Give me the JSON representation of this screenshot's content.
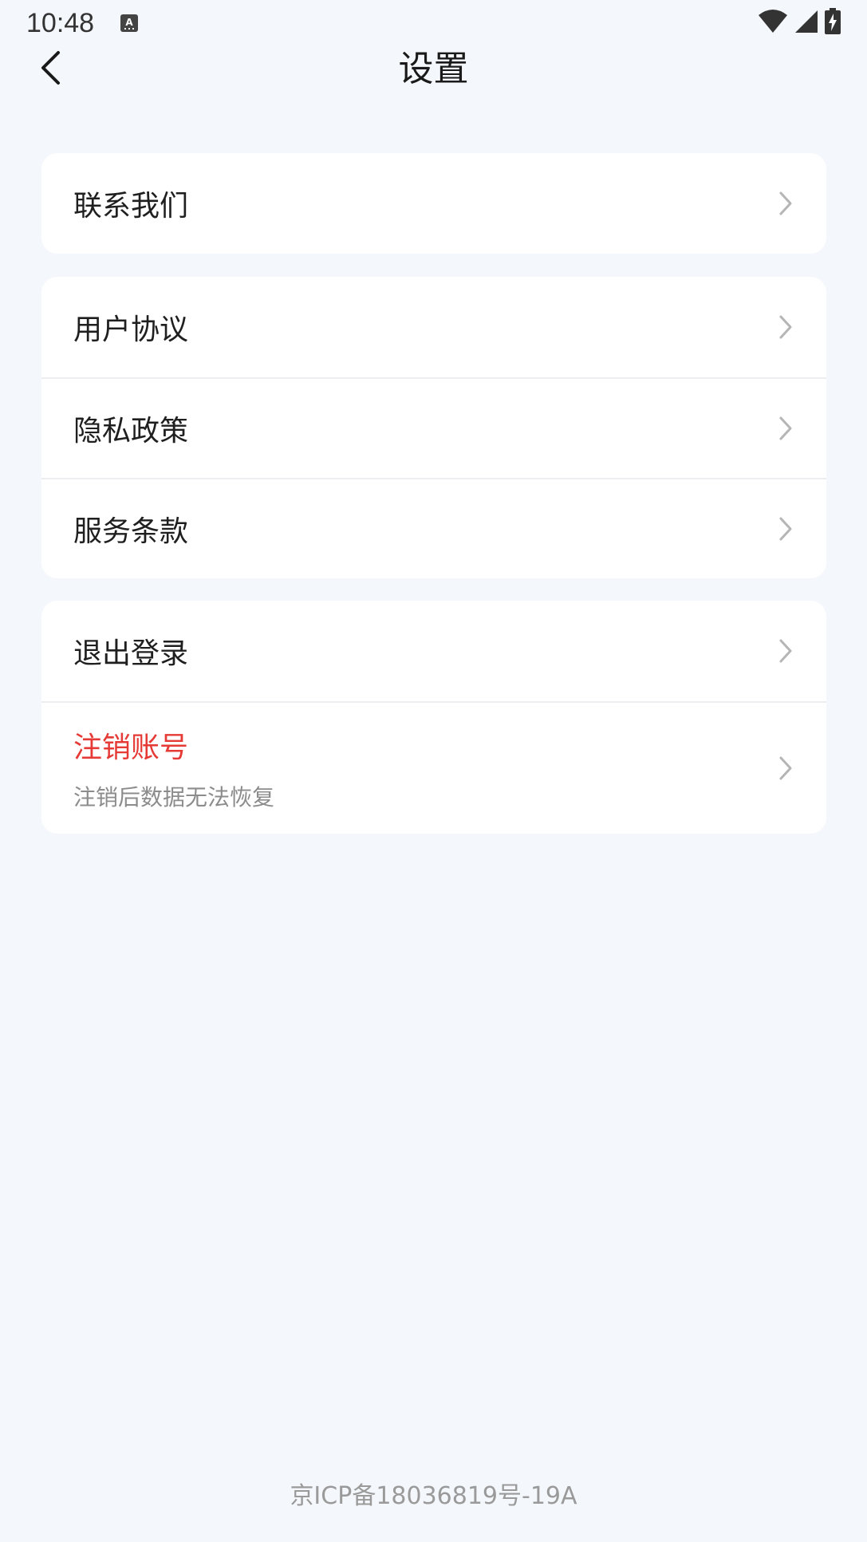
{
  "status": {
    "time": "10:48",
    "icons": [
      "a-notification-icon",
      "wifi-icon",
      "cell-signal-icon",
      "battery-charging-icon"
    ]
  },
  "nav": {
    "title": "设置",
    "back_icon": "chevron-left-icon"
  },
  "groups": [
    {
      "items": [
        {
          "label": "联系我们"
        }
      ]
    },
    {
      "items": [
        {
          "label": "用户协议"
        },
        {
          "label": "隐私政策"
        },
        {
          "label": "服务条款"
        }
      ]
    },
    {
      "items": [
        {
          "label": "退出登录"
        },
        {
          "label": "注销账号",
          "sub": "注销后数据无法恢复",
          "danger": true
        }
      ]
    }
  ],
  "footer": {
    "icp": "京ICP备18036819号-19A"
  },
  "colors": {
    "background": "#f4f7fb",
    "card": "#ffffff",
    "danger": "#e53a35",
    "chevron": "#b5b5b5"
  }
}
